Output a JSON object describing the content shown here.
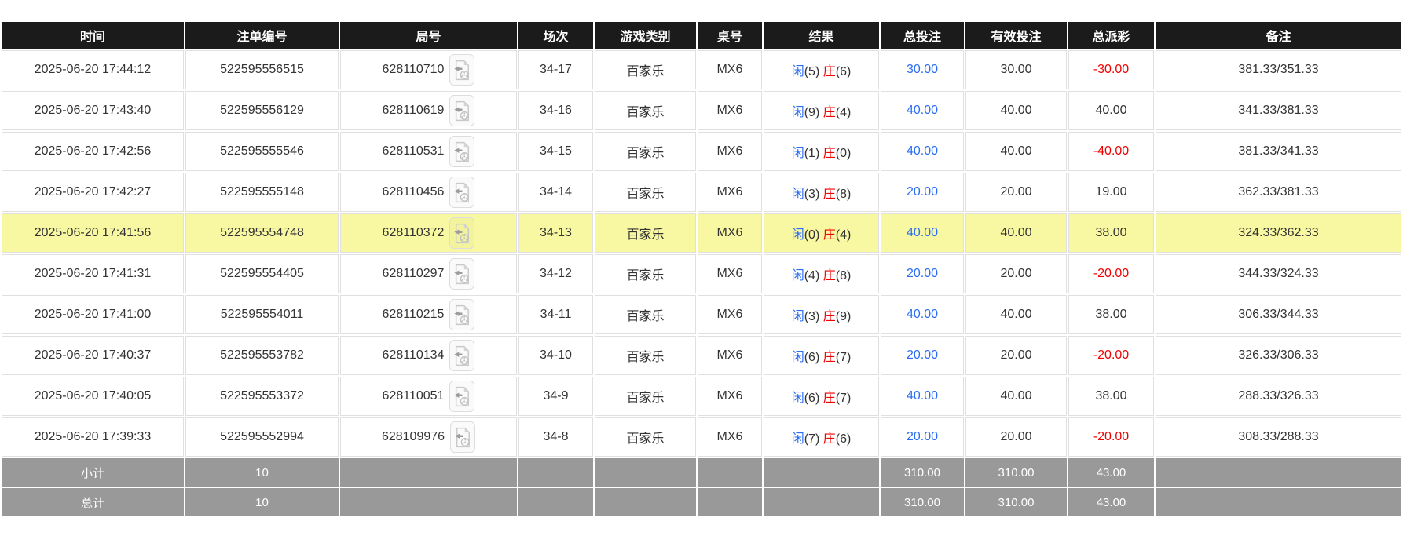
{
  "colors": {
    "blue": "#2a6df4",
    "red": "#f10000",
    "highlight_row": "#f8f8a2",
    "header_bg": "#1b1b1b",
    "summary_bg": "#999999"
  },
  "table": {
    "columns": [
      {
        "key": "time",
        "label": "时间"
      },
      {
        "key": "bet-id",
        "label": "注单编号"
      },
      {
        "key": "round-id",
        "label": "局号"
      },
      {
        "key": "session",
        "label": "场次"
      },
      {
        "key": "game-type",
        "label": "游戏类别"
      },
      {
        "key": "table-no",
        "label": "桌号"
      },
      {
        "key": "result",
        "label": "结果"
      },
      {
        "key": "total-bet",
        "label": "总投注"
      },
      {
        "key": "valid-bet",
        "label": "有效投注"
      },
      {
        "key": "total-payout",
        "label": "总派彩"
      },
      {
        "key": "remark",
        "label": "备注"
      }
    ],
    "result_labels": {
      "player": "闲",
      "banker": "庄"
    },
    "rows": [
      {
        "time": "2025-06-20 17:44:12",
        "bet_id": "522595556515",
        "round_id": "628110710",
        "session": "34-17",
        "game_type": "百家乐",
        "table_no": "MX6",
        "player": "5",
        "banker": "6",
        "total_bet": "30.00",
        "valid_bet": "30.00",
        "total_payout": "-30.00",
        "remark": "381.33/351.33",
        "highlight": false
      },
      {
        "time": "2025-06-20 17:43:40",
        "bet_id": "522595556129",
        "round_id": "628110619",
        "session": "34-16",
        "game_type": "百家乐",
        "table_no": "MX6",
        "player": "9",
        "banker": "4",
        "total_bet": "40.00",
        "valid_bet": "40.00",
        "total_payout": "40.00",
        "remark": "341.33/381.33",
        "highlight": false
      },
      {
        "time": "2025-06-20 17:42:56",
        "bet_id": "522595555546",
        "round_id": "628110531",
        "session": "34-15",
        "game_type": "百家乐",
        "table_no": "MX6",
        "player": "1",
        "banker": "0",
        "total_bet": "40.00",
        "valid_bet": "40.00",
        "total_payout": "-40.00",
        "remark": "381.33/341.33",
        "highlight": false
      },
      {
        "time": "2025-06-20 17:42:27",
        "bet_id": "522595555148",
        "round_id": "628110456",
        "session": "34-14",
        "game_type": "百家乐",
        "table_no": "MX6",
        "player": "3",
        "banker": "8",
        "total_bet": "20.00",
        "valid_bet": "20.00",
        "total_payout": "19.00",
        "remark": "362.33/381.33",
        "highlight": false
      },
      {
        "time": "2025-06-20 17:41:56",
        "bet_id": "522595554748",
        "round_id": "628110372",
        "session": "34-13",
        "game_type": "百家乐",
        "table_no": "MX6",
        "player": "0",
        "banker": "4",
        "total_bet": "40.00",
        "valid_bet": "40.00",
        "total_payout": "38.00",
        "remark": "324.33/362.33",
        "highlight": true
      },
      {
        "time": "2025-06-20 17:41:31",
        "bet_id": "522595554405",
        "round_id": "628110297",
        "session": "34-12",
        "game_type": "百家乐",
        "table_no": "MX6",
        "player": "4",
        "banker": "8",
        "total_bet": "20.00",
        "valid_bet": "20.00",
        "total_payout": "-20.00",
        "remark": "344.33/324.33",
        "highlight": false
      },
      {
        "time": "2025-06-20 17:41:00",
        "bet_id": "522595554011",
        "round_id": "628110215",
        "session": "34-11",
        "game_type": "百家乐",
        "table_no": "MX6",
        "player": "3",
        "banker": "9",
        "total_bet": "40.00",
        "valid_bet": "40.00",
        "total_payout": "38.00",
        "remark": "306.33/344.33",
        "highlight": false
      },
      {
        "time": "2025-06-20 17:40:37",
        "bet_id": "522595553782",
        "round_id": "628110134",
        "session": "34-10",
        "game_type": "百家乐",
        "table_no": "MX6",
        "player": "6",
        "banker": "7",
        "total_bet": "20.00",
        "valid_bet": "20.00",
        "total_payout": "-20.00",
        "remark": "326.33/306.33",
        "highlight": false
      },
      {
        "time": "2025-06-20 17:40:05",
        "bet_id": "522595553372",
        "round_id": "628110051",
        "session": "34-9",
        "game_type": "百家乐",
        "table_no": "MX6",
        "player": "6",
        "banker": "7",
        "total_bet": "40.00",
        "valid_bet": "40.00",
        "total_payout": "38.00",
        "remark": "288.33/326.33",
        "highlight": false
      },
      {
        "time": "2025-06-20 17:39:33",
        "bet_id": "522595552994",
        "round_id": "628109976",
        "session": "34-8",
        "game_type": "百家乐",
        "table_no": "MX6",
        "player": "7",
        "banker": "6",
        "total_bet": "20.00",
        "valid_bet": "20.00",
        "total_payout": "-20.00",
        "remark": "308.33/288.33",
        "highlight": false
      }
    ],
    "summary_rows": [
      {
        "label": "小计",
        "count": "10",
        "total_bet": "310.00",
        "valid_bet": "310.00",
        "total_payout": "43.00"
      },
      {
        "label": "总计",
        "count": "10",
        "total_bet": "310.00",
        "valid_bet": "310.00",
        "total_payout": "43.00"
      }
    ]
  }
}
